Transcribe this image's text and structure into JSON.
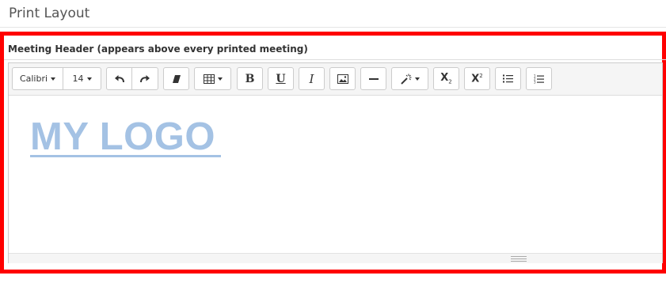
{
  "page": {
    "title": "Print Layout"
  },
  "field": {
    "label": "Meeting Header (appears above every printed meeting)"
  },
  "toolbar": {
    "font_name": "Calibri",
    "font_size": "14",
    "subscript_letter": "X",
    "subscript_mark": "2",
    "superscript_letter": "X",
    "superscript_mark": "2",
    "bold_label": "B",
    "underline_label": "U",
    "italic_label": "I",
    "icons": [
      "undo-icon",
      "redo-icon",
      "eraser-icon",
      "table-icon",
      "image-icon",
      "horizontal-rule-icon",
      "magic-wand-icon",
      "unordered-list-icon",
      "ordered-list-icon"
    ]
  },
  "editor": {
    "content_text": "MY LOGO"
  },
  "colors": {
    "highlight_border": "#ff0000",
    "logo_text": "#a4c2e4"
  }
}
